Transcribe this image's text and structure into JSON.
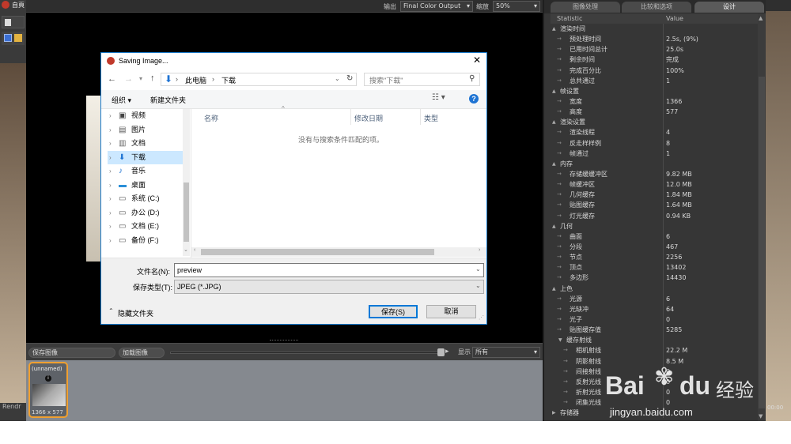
{
  "app": {
    "title_fragment": "自頁",
    "render_label": "Rendr",
    "output_label": "输出",
    "output_value": "Final Color Output",
    "zoom_label": "缩放",
    "zoom_value": "50%",
    "right_time": "00:00"
  },
  "render_bottom": {
    "save_image": "保存图像",
    "load_image": "加载图像",
    "show_label": "显示",
    "show_value": "所有"
  },
  "thumbnail": {
    "name": "(unnamed)",
    "size": "1366 x 577",
    "accent": "#f0a030"
  },
  "right_panel": {
    "tabs": [
      "图像处理",
      "比较和选项",
      "设计"
    ],
    "active_tab": 2,
    "col_statistic": "Statistic",
    "col_value": "Value",
    "rows": [
      {
        "indent": 0,
        "exp": "▲",
        "label": "渲染时间",
        "value": ""
      },
      {
        "indent": 1,
        "exp": "",
        "label": "预处理时间",
        "value": "2.5s, (9%)"
      },
      {
        "indent": 1,
        "exp": "",
        "label": "已用时间总计",
        "value": "25.0s"
      },
      {
        "indent": 1,
        "exp": "",
        "label": "剩余时间",
        "value": "完成"
      },
      {
        "indent": 1,
        "exp": "",
        "label": "完成百分比",
        "value": "100%"
      },
      {
        "indent": 1,
        "exp": "",
        "label": "总共通过",
        "value": "1"
      },
      {
        "indent": 0,
        "exp": "▲",
        "label": "帧设置",
        "value": ""
      },
      {
        "indent": 1,
        "exp": "",
        "label": "宽度",
        "value": "1366"
      },
      {
        "indent": 1,
        "exp": "",
        "label": "高度",
        "value": "577"
      },
      {
        "indent": 0,
        "exp": "▲",
        "label": "渲染设置",
        "value": ""
      },
      {
        "indent": 1,
        "exp": "",
        "label": "渲染线程",
        "value": "4"
      },
      {
        "indent": 1,
        "exp": "",
        "label": "反走样样例",
        "value": "8"
      },
      {
        "indent": 1,
        "exp": "",
        "label": "帧通过",
        "value": "1"
      },
      {
        "indent": 0,
        "exp": "▲",
        "label": "内存",
        "value": ""
      },
      {
        "indent": 1,
        "exp": "",
        "label": "存储缓缓冲区",
        "value": "9.82 MB"
      },
      {
        "indent": 1,
        "exp": "",
        "label": "帧缓冲区",
        "value": "12.0 MB"
      },
      {
        "indent": 1,
        "exp": "",
        "label": "几何缓存",
        "value": "1.84 MB"
      },
      {
        "indent": 1,
        "exp": "",
        "label": "贴图缓存",
        "value": "1.64 MB"
      },
      {
        "indent": 1,
        "exp": "",
        "label": "灯光缓存",
        "value": "0.94 KB"
      },
      {
        "indent": 0,
        "exp": "▲",
        "label": "几何",
        "value": ""
      },
      {
        "indent": 1,
        "exp": "",
        "label": "曲面",
        "value": "6"
      },
      {
        "indent": 1,
        "exp": "",
        "label": "分段",
        "value": "467"
      },
      {
        "indent": 1,
        "exp": "",
        "label": "节点",
        "value": "2256"
      },
      {
        "indent": 1,
        "exp": "",
        "label": "顶点",
        "value": "13402"
      },
      {
        "indent": 1,
        "exp": "",
        "label": "多边形",
        "value": "14430"
      },
      {
        "indent": 0,
        "exp": "▲",
        "label": "上色",
        "value": ""
      },
      {
        "indent": 1,
        "exp": "",
        "label": "光源",
        "value": "6"
      },
      {
        "indent": 1,
        "exp": "",
        "label": "光缺冲",
        "value": "64"
      },
      {
        "indent": 1,
        "exp": "",
        "label": "光子",
        "value": "0"
      },
      {
        "indent": 1,
        "exp": "",
        "label": "贴图缓存值",
        "value": "5285"
      },
      {
        "indent": 1,
        "exp": "▼",
        "label": "缓存射线",
        "value": ""
      },
      {
        "indent": 2,
        "exp": "",
        "label": "相机射线",
        "value": "22.2 M"
      },
      {
        "indent": 2,
        "exp": "",
        "label": "阴影射线",
        "value": "8.5 M"
      },
      {
        "indent": 2,
        "exp": "",
        "label": "间接射线",
        "value": "0"
      },
      {
        "indent": 2,
        "exp": "",
        "label": "反射光线",
        "value": "0"
      },
      {
        "indent": 2,
        "exp": "",
        "label": "折射光线",
        "value": "0"
      },
      {
        "indent": 2,
        "exp": "",
        "label": "闭集光线",
        "value": "0"
      },
      {
        "indent": 0,
        "exp": "▶",
        "label": "存储器",
        "value": ""
      }
    ]
  },
  "dialog": {
    "title": "Saving Image...",
    "breadcrumb": [
      "此电脑",
      "下载"
    ],
    "search_placeholder": "搜索\"下载\"",
    "organize": "组织 ▾",
    "new_folder": "新建文件夹",
    "tree": [
      {
        "icon": "video-icon",
        "label": "视频"
      },
      {
        "icon": "pictures-icon",
        "label": "图片"
      },
      {
        "icon": "documents-icon",
        "label": "文档"
      },
      {
        "icon": "download-icon",
        "label": "下载",
        "selected": true
      },
      {
        "icon": "music-icon",
        "label": "音乐"
      },
      {
        "icon": "desktop-icon",
        "label": "桌面"
      },
      {
        "icon": "drive-icon",
        "label": "系统 (C:)"
      },
      {
        "icon": "drive-icon",
        "label": "办公 (D:)"
      },
      {
        "icon": "drive-icon",
        "label": "文档 (E:)"
      },
      {
        "icon": "drive-icon",
        "label": "备份 (F:)"
      }
    ],
    "col_name": "名称",
    "col_date": "修改日期",
    "col_type": "类型",
    "empty_message": "没有与搜索条件匹配的项。",
    "filename_label": "文件名(N):",
    "filename_value": "preview",
    "filetype_label": "保存类型(T):",
    "filetype_value": "JPEG (*.JPG)",
    "hide_folders": "隐藏文件夹",
    "save": "保存(S)",
    "cancel": "取消"
  },
  "watermark": {
    "brand": "Bai",
    "brand2": "du",
    "suffix": "经验",
    "url": "jingyan.baidu.com"
  }
}
